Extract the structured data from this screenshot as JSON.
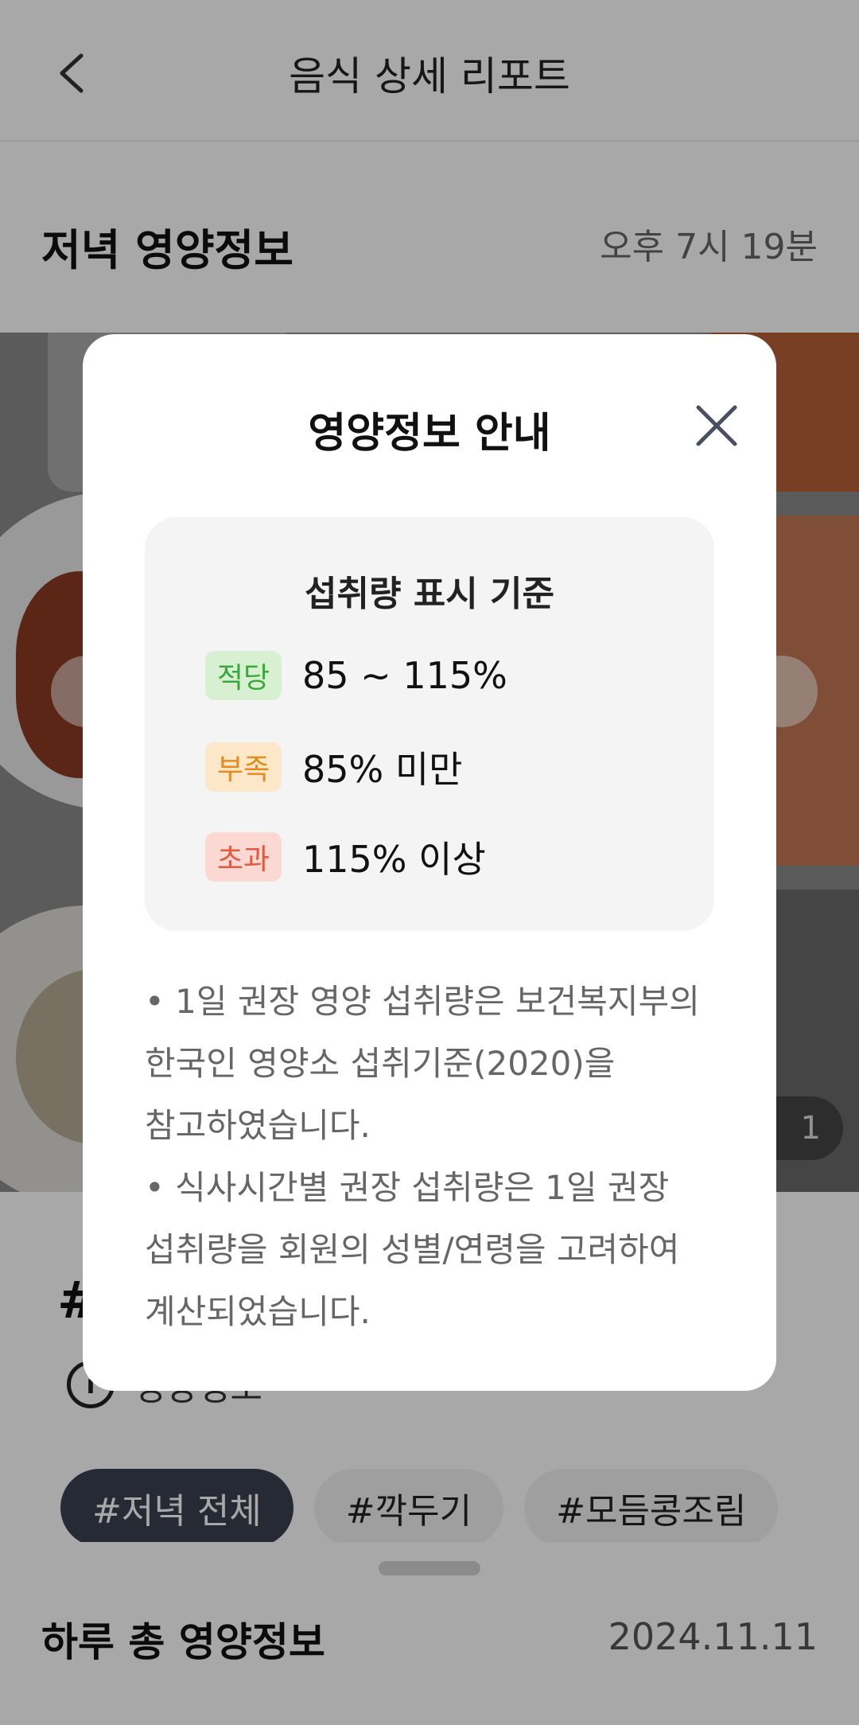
{
  "header": {
    "title": "음식 상세 리포트"
  },
  "meal": {
    "title": "저녁 영양정보",
    "time": "오후 7시 19분"
  },
  "photo": {
    "counter": "1"
  },
  "food": {
    "title_partial": "#",
    "info_icon_glyph": "i",
    "info_text_partial": "영양정보"
  },
  "chips": [
    {
      "label": "#저녁 전체",
      "active": true
    },
    {
      "label": "#깍두기",
      "active": false
    },
    {
      "label": "#모듬콩조림",
      "active": false
    }
  ],
  "sheet": {
    "title": "하루 총 영양정보",
    "date": "2024.11.11"
  },
  "modal": {
    "title": "영양정보 안내",
    "criteria_title": "섭취량 표시 기준",
    "criteria": [
      {
        "badge": "적당",
        "value": "85 ~ 115%",
        "color": "#3aa83a"
      },
      {
        "badge": "부족",
        "value": "85% 미만",
        "color": "#e68a1c"
      },
      {
        "badge": "초과",
        "value": "115% 이상",
        "color": "#e05a40"
      }
    ],
    "notes": [
      "• 1일 권장 영양 섭취량은 보건복지부의",
      "한국인 영양소 섭취기준(2020)을",
      "참고하였습니다.",
      "• 식사시간별 권장 섭취량은 1일 권장",
      "섭취량을 회원의 성별/연령을 고려하여",
      "계산되었습니다."
    ]
  }
}
